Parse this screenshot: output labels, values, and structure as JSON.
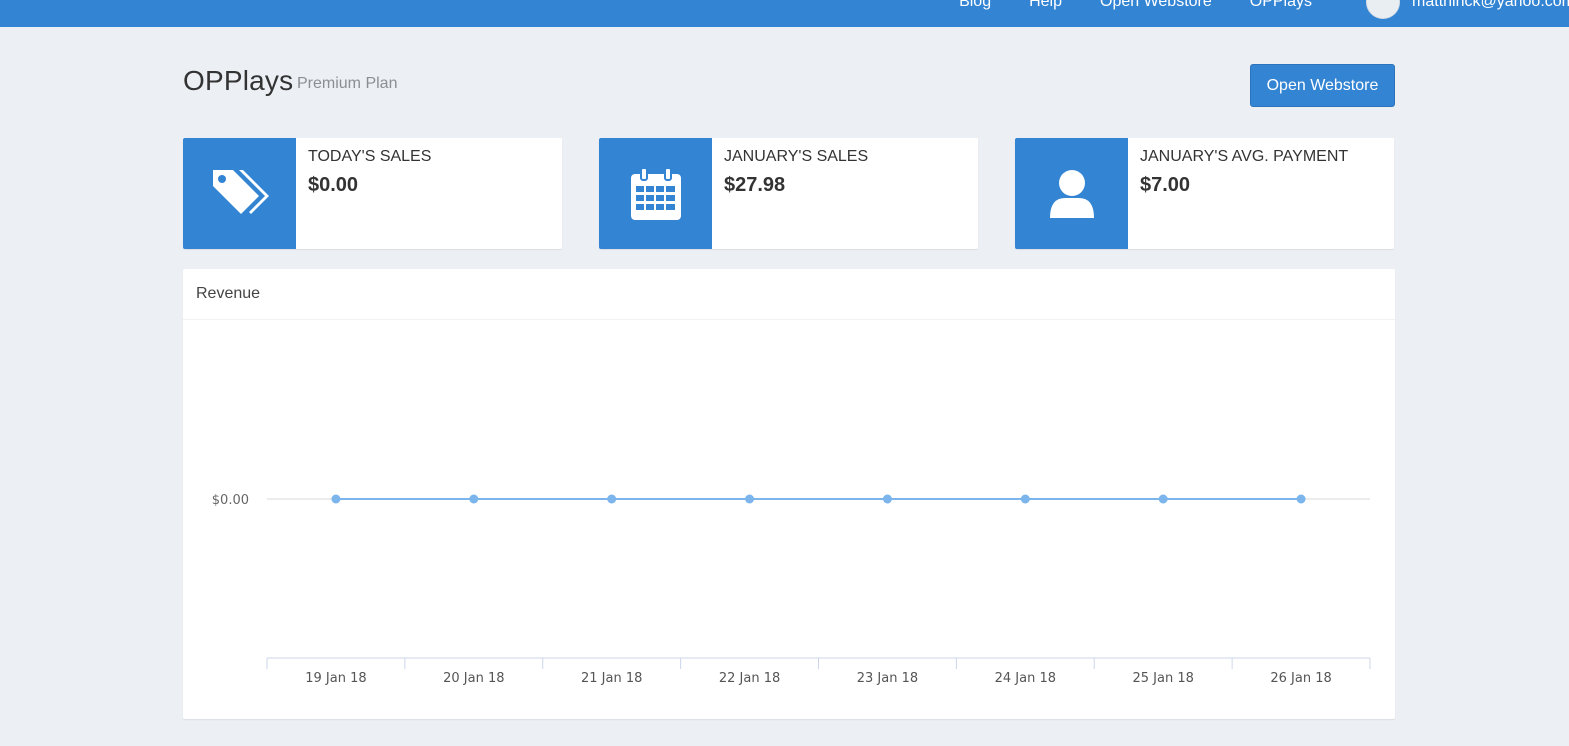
{
  "topnav": {
    "items": [
      "Blog",
      "Help",
      "Open Webstore",
      "OPPlays"
    ],
    "user": "matthinck@yahoo.com"
  },
  "header": {
    "title": "OPPlays",
    "plan": "Premium Plan",
    "open_webstore_label": "Open Webstore"
  },
  "stats": [
    {
      "label": "TODAY'S SALES",
      "value": "$0.00",
      "icon": "tags-icon"
    },
    {
      "label": "JANUARY'S SALES",
      "value": "$27.98",
      "icon": "calendar-icon"
    },
    {
      "label": "JANUARY'S AVG. PAYMENT",
      "value": "$7.00",
      "icon": "user-icon"
    }
  ],
  "revenue": {
    "title": "Revenue"
  },
  "colors": {
    "brand": "#3384d3",
    "line": "#7cb5ec",
    "background": "#ecf0f5"
  },
  "chart_data": {
    "type": "line",
    "title": "",
    "categories": [
      "19 Jan 18",
      "20 Jan 18",
      "21 Jan 18",
      "22 Jan 18",
      "23 Jan 18",
      "24 Jan 18",
      "25 Jan 18",
      "26 Jan 18"
    ],
    "series": [
      {
        "values": [
          0,
          0,
          0,
          0,
          0,
          0,
          0,
          0
        ]
      }
    ],
    "yticks": [
      "$0.00"
    ],
    "ylim": [
      -1,
      1
    ],
    "grid": true,
    "legend": "none"
  }
}
